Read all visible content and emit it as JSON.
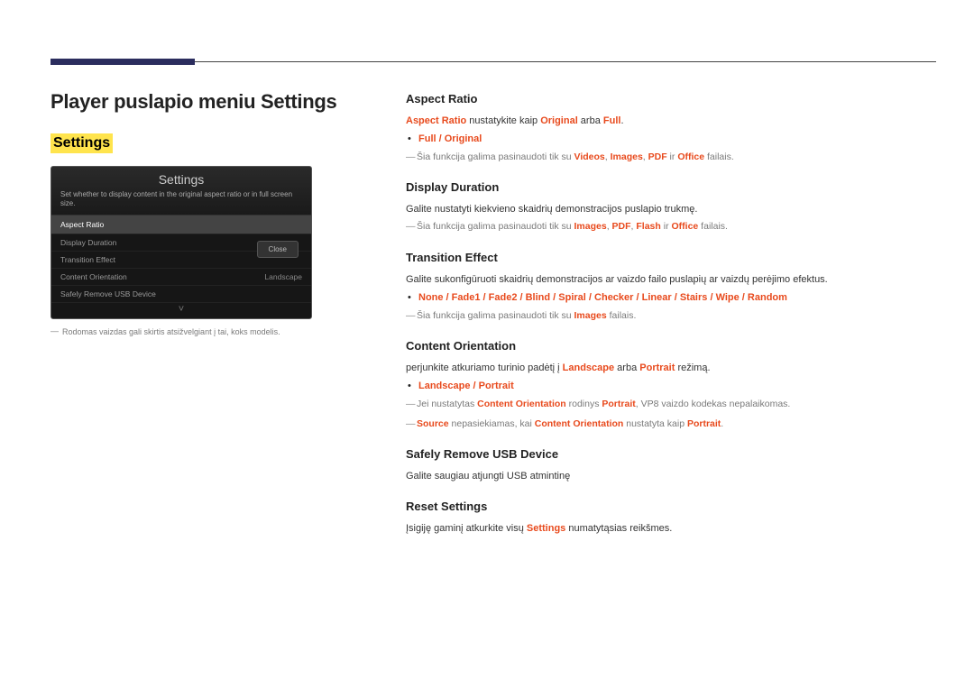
{
  "page_title": "Player puslapio meniu Settings",
  "settings_heading": "Settings",
  "device": {
    "title": "Settings",
    "subtitle": "Set whether to display content in the original aspect ratio or in full screen size.",
    "rows": [
      {
        "label": "Aspect Ratio",
        "value": "",
        "selected": true
      },
      {
        "label": "Display Duration",
        "value": "",
        "selected": false
      },
      {
        "label": "Transition Effect",
        "value": "",
        "selected": false
      },
      {
        "label": "Content Orientation",
        "value": "Landscape",
        "selected": false
      },
      {
        "label": "Safely Remove USB Device",
        "value": "",
        "selected": false
      }
    ],
    "close_label": "Close",
    "chevron": "˅",
    "footnote_dash": "―",
    "footnote": "Rodomas vaizdas gali skirtis atsižvelgiant į tai, koks modelis."
  },
  "aspect_ratio": {
    "title": "Aspect Ratio",
    "line1_pre": "Aspect Ratio",
    "line1_mid": " nustatykite kaip ",
    "line1_opt1": "Original",
    "line1_mid2": " arba ",
    "line1_opt2": "Full",
    "line1_end": ".",
    "bullet_opt1": "Full",
    "bullet_sep": " / ",
    "bullet_opt2": "Original",
    "note_dash": "―",
    "note_pre": "Šia funkcija galima pasinaudoti tik su ",
    "note_k1": "Videos",
    "note_k2": "Images",
    "note_k3": "PDF",
    "note_k4_pre": " ir ",
    "note_k4": "Office",
    "note_end": " failais.",
    "comma": ", "
  },
  "display_duration": {
    "title": "Display Duration",
    "line": "Galite nustatyti kiekvieno skaidrių demonstracijos puslapio trukmę.",
    "note_dash": "―",
    "note_pre": "Šia funkcija galima pasinaudoti tik su ",
    "note_k1": "Images",
    "note_k2": "PDF",
    "note_k3": "Flash",
    "note_k4_pre": " ir ",
    "note_k4": "Office",
    "note_end": " failais.",
    "comma": ", "
  },
  "transition": {
    "title": "Transition Effect",
    "line": "Galite sukonfigūruoti skaidrių demonstracijos ar vaizdo failo puslapių ar vaizdų perėjimo efektus.",
    "opts": [
      "None",
      "Fade1",
      "Fade2",
      "Blind",
      "Spiral",
      "Checker",
      "Linear",
      "Stairs",
      "Wipe",
      "Random"
    ],
    "sep": " / ",
    "note_dash": "―",
    "note_pre": "Šia funkcija galima pasinaudoti tik su ",
    "note_k1": "Images",
    "note_end": " failais."
  },
  "orientation": {
    "title": "Content Orientation",
    "line_pre": "perjunkite atkuriamo turinio padėtį į ",
    "k1": "Landscape",
    "mid": " arba ",
    "k2": "Portrait",
    "line_end": " režimą.",
    "bullet_opt1": "Landscape",
    "bullet_sep": " / ",
    "bullet_opt2": "Portrait",
    "note1_dash": "―",
    "note1_pre": "Jei nustatytas ",
    "note1_k1": "Content Orientation",
    "note1_mid": " rodinys ",
    "note1_k2": "Portrait",
    "note1_end": ", VP8 vaizdo kodekas nepalaikomas.",
    "note2_dash": "―",
    "note2_k1": "Source",
    "note2_mid1": " nepasiekiamas, kai ",
    "note2_k2": "Content Orientation",
    "note2_mid2": " nustatyta kaip ",
    "note2_k3": "Portrait",
    "note2_end": "."
  },
  "safely_remove": {
    "title": "Safely Remove USB Device",
    "line": "Galite saugiau atjungti USB atmintinę"
  },
  "reset": {
    "title": "Reset Settings",
    "line_pre": "Įsigiję gaminį atkurkite visų ",
    "k1": "Settings",
    "line_end": " numatytąsias reikšmes."
  }
}
